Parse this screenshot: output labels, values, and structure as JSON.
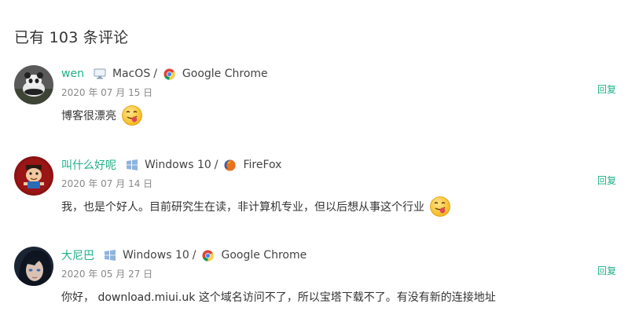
{
  "heading": "已有 103 条评论",
  "reply_label": "回复",
  "colors": {
    "accent": "#1fb186",
    "text": "#333333",
    "muted": "#888888"
  },
  "comments": [
    {
      "author": "wen",
      "os": "MacOS",
      "os_icon": "monitor-icon",
      "separator": "/",
      "browser": "Google Chrome",
      "browser_icon": "chrome-icon",
      "date": "2020 年 07 月 15 日",
      "text": "博客很漂亮",
      "emoji": "tongue-out-emoji"
    },
    {
      "author": "叫什么好呢",
      "os": "Windows 10",
      "os_icon": "windows-icon",
      "separator": "/",
      "browser": "FireFox",
      "browser_icon": "firefox-icon",
      "date": "2020 年 07 月 14 日",
      "text": "我，也是个好人。目前研究生在读，非计算机专业，但以后想从事这个行业",
      "emoji": "tongue-out-emoji"
    },
    {
      "author": "大尼巴",
      "os": "Windows 10",
      "os_icon": "windows-icon",
      "separator": "/",
      "browser": "Google Chrome",
      "browser_icon": "chrome-icon",
      "date": "2020 年 05 月 27 日",
      "text": "你好， download.miui.uk 这个域名访问不了，所以宝塔下载不了。有没有新的连接地址"
    }
  ]
}
